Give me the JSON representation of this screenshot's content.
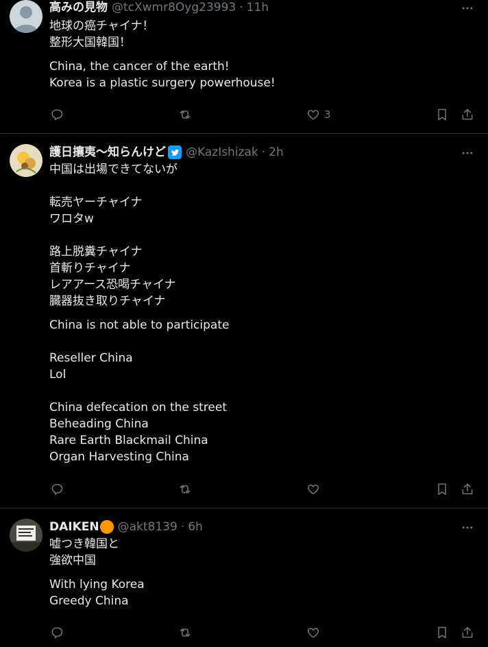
{
  "tweets": [
    {
      "display_name": "高みの見物",
      "handle": "@tcXwmr8Oyg23993",
      "separator": "·",
      "time": "11h",
      "original_lines": [
        "地球の癌チャイナ！",
        "整形大国韓国！"
      ],
      "translated_lines": [
        "China, the cancer of the earth!",
        "Korea is a plastic surgery powerhouse!"
      ],
      "like_count": "3",
      "badge_icon": "none",
      "avatar_icon": "default-avatar-icon"
    },
    {
      "display_name": "護日攘夷～知らんけど",
      "handle": "@KazIshizak",
      "separator": "·",
      "time": "2h",
      "original_lines": [
        "中国は出場できてないが",
        "",
        "転売ヤーチャイナ",
        "ワロタw",
        "",
        "路上脱糞チャイナ",
        "首斬りチャイナ",
        "レアアース恐喝チャイナ",
        "臓器抜き取りチャイナ"
      ],
      "translated_lines": [
        "China is not able to participate",
        "",
        "Reseller China",
        "Lol",
        "",
        "China defecation on the street",
        "Beheading China",
        "Rare Earth Blackmail China",
        "Organ Harvesting China"
      ],
      "like_count": "",
      "badge_icon": "twitter-bird-badge-icon",
      "avatar_icon": "flower-avatar-icon"
    },
    {
      "display_name": "DAIKEN",
      "handle": "@akt8139",
      "separator": "·",
      "time": "6h",
      "original_lines": [
        "嘘つき韓国と",
        "強欲中国"
      ],
      "translated_lines": [
        "With lying Korea",
        "Greedy China"
      ],
      "like_count": "",
      "badge_icon": "orange-circle-icon",
      "avatar_icon": "sign-photo-avatar-icon"
    }
  ],
  "colors": {
    "background": "#000000",
    "text": "#e7e9ea",
    "muted": "#71767b",
    "border": "#2f3336",
    "accent_blue": "#1d9bf0",
    "orange": "#ff9800"
  },
  "icons": {
    "reply": "reply-icon",
    "retweet": "retweet-icon",
    "like": "heart-icon",
    "bookmark": "bookmark-icon",
    "share": "share-icon",
    "more": "more-icon"
  }
}
